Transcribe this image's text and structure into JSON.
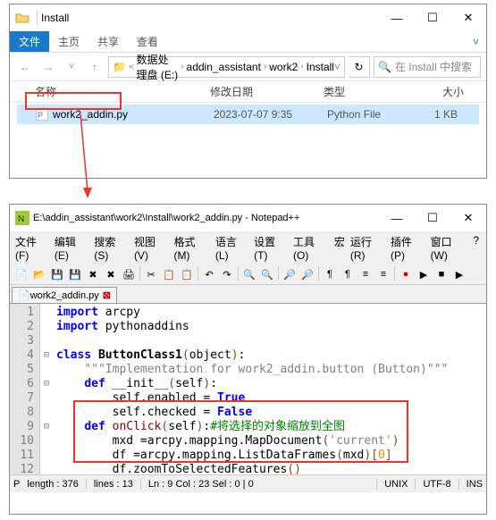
{
  "explorer": {
    "title": "Install",
    "tabs": {
      "file": "主页",
      "share": "共享",
      "view": "查看"
    },
    "breadcrumb": [
      "数据处理盘 (E:)",
      "addin_assistant",
      "work2",
      "Install"
    ],
    "search_placeholder": "在 Install 中搜索",
    "headers": {
      "name": "名称",
      "date": "修改日期",
      "type": "类型",
      "size": "大小"
    },
    "file": {
      "name": "work2_addin.py",
      "date": "2023-07-07 9:35",
      "type": "Python File",
      "size": "1 KB"
    }
  },
  "notepad": {
    "title": "E:\\addin_assistant\\work2\\Install\\work2_addin.py - Notepad++",
    "menus": [
      "文件(F)",
      "编辑(E)",
      "搜索(S)",
      "视图(V)",
      "格式(M)",
      "语言(L)",
      "设置(T)",
      "工具(O)",
      "宏",
      "运行(R)",
      "插件(P)",
      "窗口(W)",
      "?"
    ],
    "tab": "work2_addin.py",
    "code": {
      "lines": [
        "1",
        "2",
        "3",
        "4",
        "5",
        "6",
        "7",
        "8",
        "9",
        "10",
        "11",
        "12",
        ""
      ],
      "l1_kw": "import",
      "l1_mod": "arcpy",
      "l2_kw": "import",
      "l2_mod": "pythonaddins",
      "l4_kw": "class",
      "l4_name": "ButtonClass1",
      "l4_obj": "object",
      "l5_doc": "\"\"\"Implementation for work2_addin.button (Button)\"\"\"",
      "l6_kw": "def",
      "l6_name": "__init__",
      "l6_arg": "self",
      "l7": "self.enabled = ",
      "l7_val": "True",
      "l8": "self.checked = ",
      "l8_val": "False",
      "l9_kw": "def",
      "l9_name": "onClick",
      "l9_arg": "self",
      "l9_cm": "#将选择的对象缩放到全图",
      "l10a": "mxd =arcpy.mapping.MapDocument",
      "l10b": "'current'",
      "l11a": "df =arcpy.mapping.ListDataFrames",
      "l11b": "mxd",
      "l11c": "0",
      "l12": "df.zoomToSelectedFeatures"
    },
    "status": {
      "length": "length : 376",
      "lines": "lines : 13",
      "pos": "Ln : 9    Col : 23    Sel : 0 | 0",
      "eol": "UNIX",
      "enc": "UTF-8",
      "ins": "INS"
    }
  }
}
